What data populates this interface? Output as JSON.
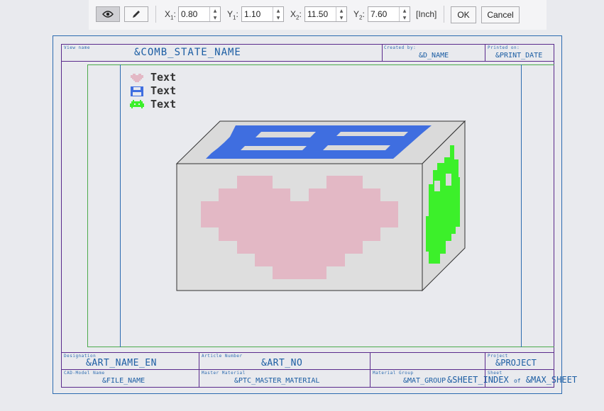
{
  "toolbar": {
    "x1_label": "X",
    "x1_sub": "1",
    "x1_value": "0.80",
    "y1_label": "Y",
    "y1_sub": "1",
    "y1_value": "1.10",
    "x2_label": "X",
    "x2_sub": "2",
    "x2_value": "11.50",
    "y2_label": "Y",
    "y2_sub": "2",
    "y2_value": "7.60",
    "unit": "[Inch]",
    "ok_label": "OK",
    "cancel_label": "Cancel"
  },
  "header": {
    "view_label": "View name",
    "view_value": "&COMB_STATE_NAME",
    "created_label": "Created by:",
    "created_value": "&D_NAME",
    "printed_label": "Printed on:",
    "printed_value": "&PRINT_DATE"
  },
  "legend": [
    {
      "icon": "heart-icon",
      "text": "Text",
      "color": "#e3b8c5"
    },
    {
      "icon": "floppy-icon",
      "text": "Text",
      "color": "#3f6ee0"
    },
    {
      "icon": "invader-icon",
      "text": "Text",
      "color": "#3cf02a"
    }
  ],
  "title_block": {
    "designation_label": "Designation",
    "designation_value": "&ART_NAME_EN",
    "article_label": "Article Number",
    "article_value": "&ART_NO",
    "project_label": "Project",
    "project_value": "&PROJECT",
    "cad_label": "CAD-Model Name",
    "cad_value": "&FILE_NAME",
    "material_label": "Master Material",
    "material_value": "&PTC_MASTER_MATERIAL",
    "group_label": "Material Group",
    "group_value": "&MAT_GROUP",
    "sheet_label": "Sheet",
    "sheet_value": "&SHEET_INDEX",
    "sheet_of": "of",
    "sheet_max": "&MAX_SHEET"
  },
  "colors": {
    "frame_blue": "#2c6bb0",
    "frame_purple": "#5a2a8c",
    "frame_green": "#4caa4c",
    "heart": "#e3b8c5",
    "floppy": "#3f6ee0",
    "invader": "#3cf02a"
  }
}
